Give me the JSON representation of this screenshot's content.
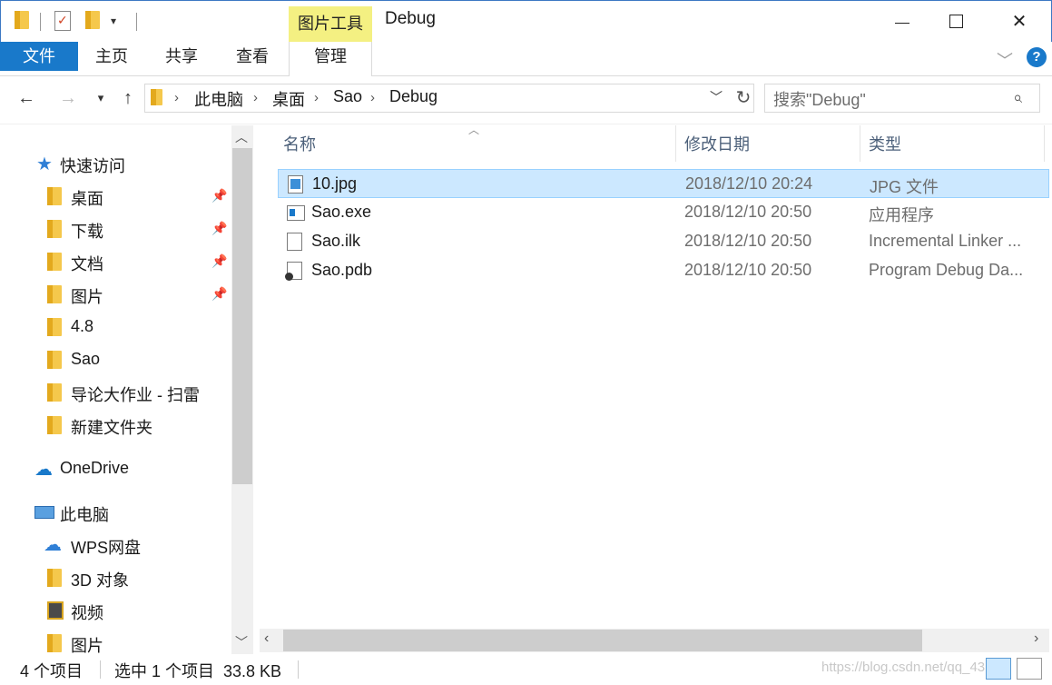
{
  "window": {
    "context_tab": "图片工具",
    "title": "Debug"
  },
  "ribbon": {
    "tabs": [
      "文件",
      "主页",
      "共享",
      "查看",
      "管理"
    ]
  },
  "address": {
    "crumbs": [
      "此电脑",
      "桌面",
      "Sao",
      "Debug"
    ],
    "search_placeholder": "搜索\"Debug\""
  },
  "nav": {
    "quick_access": "快速访问",
    "pinned": [
      "桌面",
      "下载",
      "文档",
      "图片"
    ],
    "recent": [
      "4.8",
      "Sao",
      "导论大作业 - 扫雷",
      "新建文件夹"
    ],
    "onedrive": "OneDrive",
    "this_pc": "此电脑",
    "pc_items": [
      "WPS网盘",
      "3D 对象",
      "视频",
      "图片"
    ]
  },
  "columns": {
    "name": "名称",
    "date": "修改日期",
    "type": "类型"
  },
  "files": [
    {
      "name": "10.jpg",
      "date": "2018/12/10 20:24",
      "type": "JPG 文件",
      "icon": "image-file-icon",
      "selected": true
    },
    {
      "name": "Sao.exe",
      "date": "2018/12/10 20:50",
      "type": "应用程序",
      "icon": "exe-file-icon",
      "selected": false
    },
    {
      "name": "Sao.ilk",
      "date": "2018/12/10 20:50",
      "type": "Incremental Linker ...",
      "icon": "ilk-file-icon",
      "selected": false
    },
    {
      "name": "Sao.pdb",
      "date": "2018/12/10 20:50",
      "type": "Program Debug Da...",
      "icon": "pdb-file-icon",
      "selected": false
    }
  ],
  "status": {
    "count": "4 个项目",
    "selection": "选中 1 个项目  33.8 KB",
    "watermark": "https://blog.csdn.net/qq_43.."
  }
}
